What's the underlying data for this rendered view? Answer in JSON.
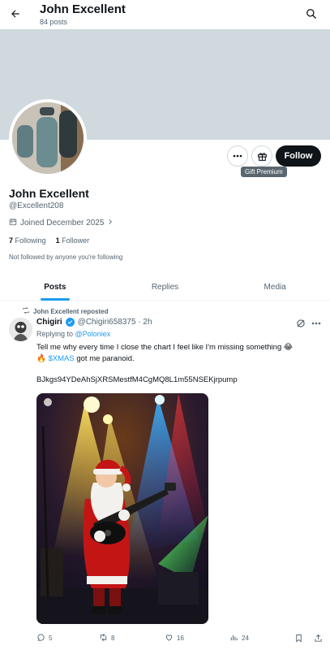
{
  "header": {
    "title": "John Excellent",
    "post_count": "84 posts"
  },
  "profile": {
    "name": "John Excellent",
    "handle": "@Excellent208",
    "joined": "Joined December 2025",
    "following_count": "7",
    "following_label": "Following",
    "followers_count": "1",
    "followers_label": "Follower",
    "not_followed": "Not followed by anyone you're following"
  },
  "actions": {
    "gift_tooltip": "Gift Premium",
    "follow_label": "Follow"
  },
  "tabs": [
    {
      "label": "Posts",
      "active": true
    },
    {
      "label": "Replies",
      "active": false
    },
    {
      "label": "Media",
      "active": false
    }
  ],
  "post": {
    "repost_label": "John Excellent reposted",
    "author_name": "Chigiri",
    "author_handle_time": "@Chigiri658375 · 2h",
    "replying_prefix": "Replying to",
    "replying_mention": "@Poloniex",
    "text_line1": "Tell me why every time I close the chart I feel like I'm missing something 😂",
    "text_fire": "🔥",
    "cashtag": "$XMAS",
    "text_line2_rest": " got me paranoid.",
    "code": "BJkgs94YDeAhSjXRSMestfM4CgMQ8L1m55NSEKjrpump",
    "replies": "5",
    "reposts": "8",
    "likes": "16",
    "views": "24"
  },
  "colors": {
    "accent": "#1d9bf0",
    "text": "#0f1419",
    "secondary": "#536471",
    "banner": "#cfd9de"
  }
}
